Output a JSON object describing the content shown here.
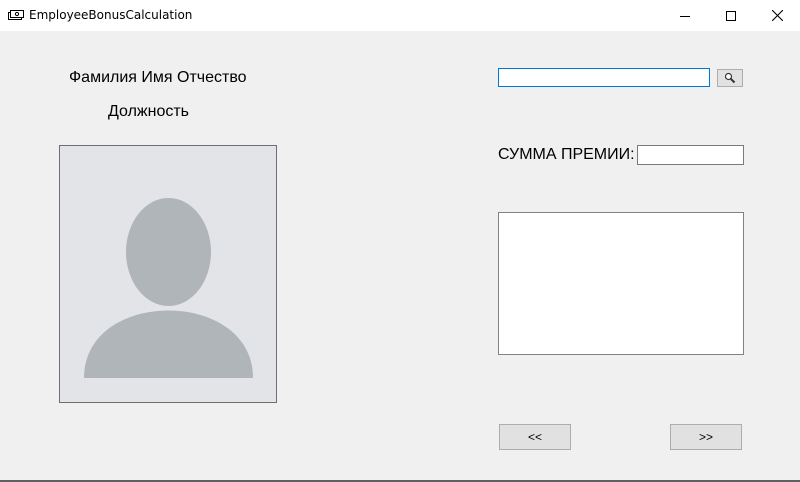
{
  "window": {
    "title": "EmployeeBonusCalculation",
    "app_icon": "money-icon",
    "controls": [
      "minimize-icon",
      "maximize-icon",
      "close-icon"
    ]
  },
  "employee": {
    "full_name_label": "Фамилия Имя Отчество",
    "position_label": "Должность",
    "photo_icon": "avatar-placeholder-icon"
  },
  "search": {
    "value": "",
    "button_icon": "search-icon"
  },
  "bonus": {
    "label": "СУММА ПРЕМИИ:",
    "value": ""
  },
  "details": {
    "value": ""
  },
  "navigation": {
    "prev_label": "<<",
    "next_label": ">>"
  },
  "colors": {
    "window_bg": "#f0f0f0",
    "titlebar_bg": "#ffffff",
    "focus_border": "#0078d7",
    "placeholder_bg": "#e2e4e7",
    "placeholder_fg": "#b0b5ba"
  }
}
